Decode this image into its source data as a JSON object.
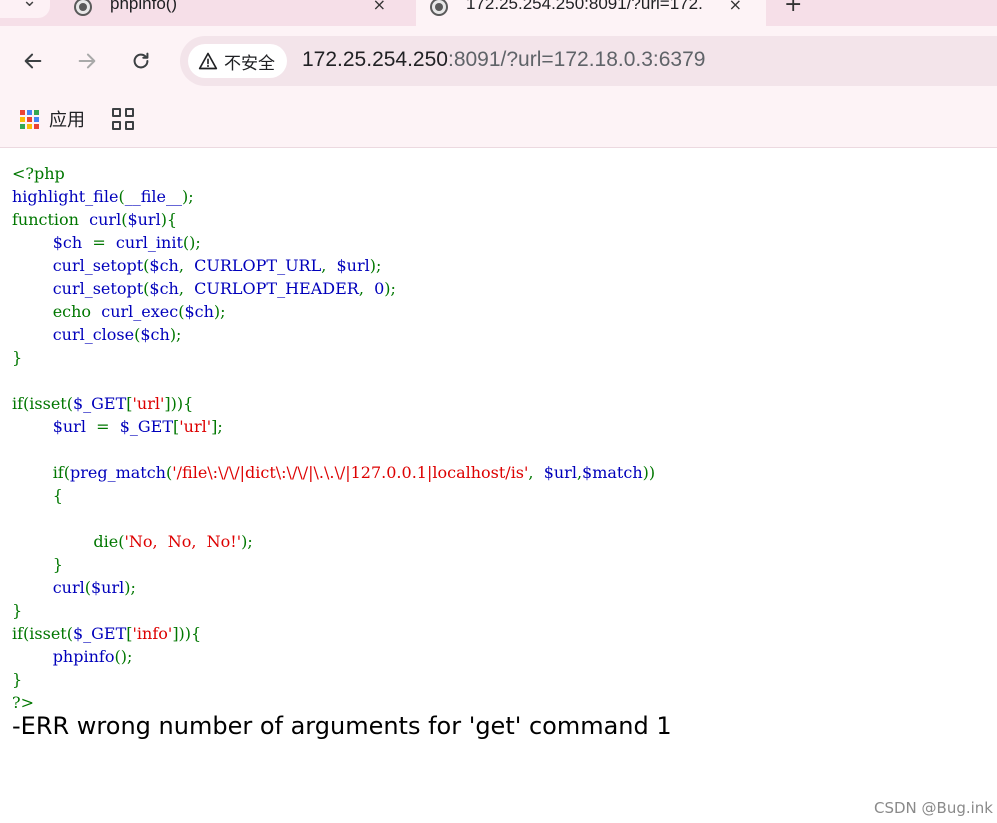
{
  "browser": {
    "tabs": [
      {
        "title": "phpinfo()",
        "active": false
      },
      {
        "title": "172.25.254.250:8091/?url=172.",
        "active": true
      }
    ],
    "new_tab_glyph": "+",
    "close_glyph": "×",
    "security_label": "不安全",
    "url_host": "172.25.254.250",
    "url_rest": ":8091/?url=172.18.0.3:6379"
  },
  "bookmarks": {
    "apps_label": "应用",
    "apps_colors": [
      "#ea4335",
      "#4285f4",
      "#34a853",
      "#fbbc05",
      "#ea4335",
      "#4285f4",
      "#34a853",
      "#fbbc05",
      "#ea4335"
    ]
  },
  "code_colors": {
    "keyword": "#007700",
    "default": "#0000BB",
    "string": "#DD0000"
  },
  "code_lines": [
    [
      [
        "k",
        "<?php"
      ]
    ],
    [
      [
        "d",
        "highlight_file"
      ],
      [
        "k",
        "("
      ],
      [
        "d",
        "__file__"
      ],
      [
        "k",
        ");"
      ]
    ],
    [
      [
        "k",
        "function  "
      ],
      [
        "d",
        "curl"
      ],
      [
        "k",
        "("
      ],
      [
        "d",
        "$url"
      ],
      [
        "k",
        "){"
      ]
    ],
    [
      [
        "d",
        "        $ch  "
      ],
      [
        "k",
        "=  "
      ],
      [
        "d",
        "curl_init"
      ],
      [
        "k",
        "();"
      ]
    ],
    [
      [
        "d",
        "        curl_setopt"
      ],
      [
        "k",
        "("
      ],
      [
        "d",
        "$ch"
      ],
      [
        "k",
        ",  "
      ],
      [
        "d",
        "CURLOPT_URL"
      ],
      [
        "k",
        ",  "
      ],
      [
        "d",
        "$url"
      ],
      [
        "k",
        ");"
      ]
    ],
    [
      [
        "d",
        "        curl_setopt"
      ],
      [
        "k",
        "("
      ],
      [
        "d",
        "$ch"
      ],
      [
        "k",
        ",  "
      ],
      [
        "d",
        "CURLOPT_HEADER"
      ],
      [
        "k",
        ",  "
      ],
      [
        "d",
        "0"
      ],
      [
        "k",
        ");"
      ]
    ],
    [
      [
        "k",
        "        echo  "
      ],
      [
        "d",
        "curl_exec"
      ],
      [
        "k",
        "("
      ],
      [
        "d",
        "$ch"
      ],
      [
        "k",
        ");"
      ]
    ],
    [
      [
        "d",
        "        curl_close"
      ],
      [
        "k",
        "("
      ],
      [
        "d",
        "$ch"
      ],
      [
        "k",
        ");"
      ]
    ],
    [
      [
        "k",
        "}"
      ]
    ],
    [],
    [
      [
        "k",
        "if(isset("
      ],
      [
        "d",
        "$_GET"
      ],
      [
        "k",
        "["
      ],
      [
        "s",
        "'url'"
      ],
      [
        "k",
        "])){"
      ]
    ],
    [
      [
        "d",
        "        $url  "
      ],
      [
        "k",
        "=  "
      ],
      [
        "d",
        "$_GET"
      ],
      [
        "k",
        "["
      ],
      [
        "s",
        "'url'"
      ],
      [
        "k",
        "];"
      ]
    ],
    [],
    [
      [
        "k",
        "        if("
      ],
      [
        "d",
        "preg_match"
      ],
      [
        "k",
        "("
      ],
      [
        "s",
        "'/file\\:\\/\\/|dict\\:\\/\\/|\\.\\.\\/|127.0.0.1|localhost/is'"
      ],
      [
        "k",
        ",  "
      ],
      [
        "d",
        "$url"
      ],
      [
        "k",
        ","
      ],
      [
        "d",
        "$match"
      ],
      [
        "k",
        "))"
      ]
    ],
    [
      [
        "k",
        "        {"
      ]
    ],
    [],
    [
      [
        "k",
        "                die("
      ],
      [
        "s",
        "'No,  No,  No!'"
      ],
      [
        "k",
        ");"
      ]
    ],
    [
      [
        "k",
        "        }"
      ]
    ],
    [
      [
        "d",
        "        curl"
      ],
      [
        "k",
        "("
      ],
      [
        "d",
        "$url"
      ],
      [
        "k",
        ");"
      ]
    ],
    [
      [
        "k",
        "}"
      ]
    ],
    [
      [
        "k",
        "if(isset("
      ],
      [
        "d",
        "$_GET"
      ],
      [
        "k",
        "["
      ],
      [
        "s",
        "'info'"
      ],
      [
        "k",
        "])){"
      ]
    ],
    [
      [
        "d",
        "        phpinfo"
      ],
      [
        "k",
        "();"
      ]
    ],
    [
      [
        "k",
        "}"
      ]
    ],
    [
      [
        "k",
        "?>"
      ]
    ]
  ],
  "output_text": "-ERR wrong number of arguments for 'get' command 1",
  "watermark": "CSDN @Bug.ink"
}
